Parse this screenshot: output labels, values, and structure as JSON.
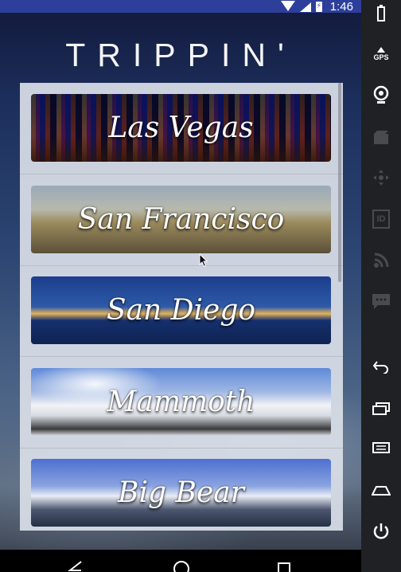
{
  "status_bar": {
    "time": "1:46",
    "battery_label": "⚡"
  },
  "app": {
    "title": "TRIPPIN'"
  },
  "destinations": [
    {
      "name": "Las Vegas"
    },
    {
      "name": "San Francisco"
    },
    {
      "name": "San Diego"
    },
    {
      "name": "Mammoth"
    },
    {
      "name": "Big Bear"
    }
  ],
  "toolbar": {
    "gps_label": "GPS",
    "id_label": "ID"
  },
  "icons": {
    "wifi": "wifi-icon",
    "signal": "signal-icon",
    "battery": "battery-icon",
    "back": "back-icon",
    "home": "home-icon",
    "recents": "recents-icon"
  }
}
